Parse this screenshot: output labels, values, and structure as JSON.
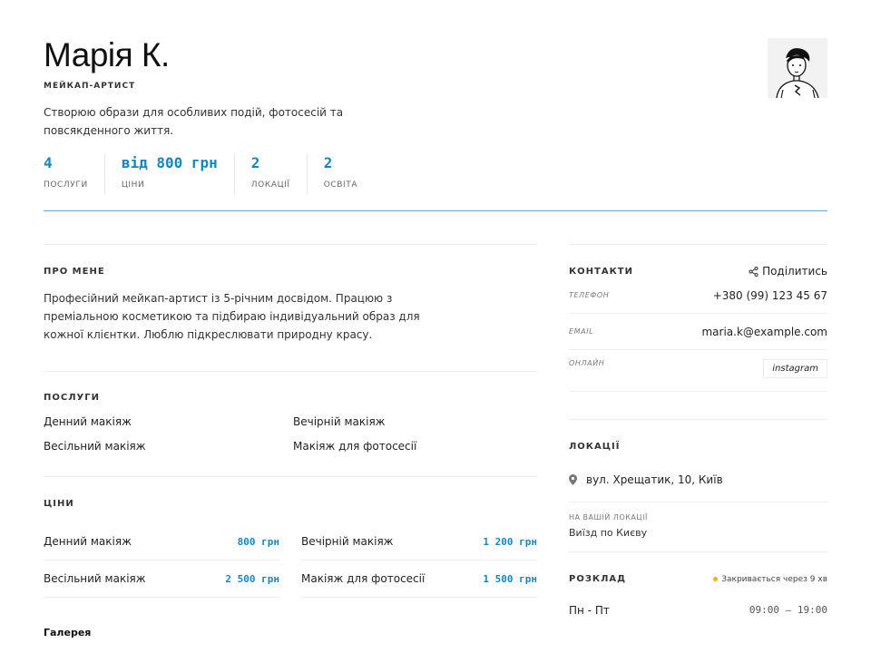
{
  "profile": {
    "name": "Марія К.",
    "role": "МЕЙКАП-АРТИСТ",
    "bio": "Створюю образи для особливих подій, фотосесій та повсякденного життя.",
    "avatar_icon": "person-illustration-icon"
  },
  "stats": [
    {
      "value": "4",
      "label": "ПОСЛУГИ"
    },
    {
      "value": "від 800 грн",
      "label": "ЦІНИ"
    },
    {
      "value": "2",
      "label": "ЛОКАЦІЇ"
    },
    {
      "value": "2",
      "label": "ОСВІТА"
    }
  ],
  "about": {
    "title": "ПРО МЕНЕ",
    "text": "Професійний мейкап-артист із 5-річним досвідом. Працюю з преміальною косметикою та підбираю індивідуальний образ для кожної клієнтки. Люблю підкреслювати природну красу."
  },
  "services": {
    "title": "ПОСЛУГИ",
    "items": [
      "Денний макіяж",
      "Вечірній макіяж",
      "Весільний макіяж",
      "Макіяж для фотосесії"
    ]
  },
  "prices": {
    "title": "ЦІНИ",
    "items": [
      {
        "name": "Денний макіяж",
        "price": "800 грн"
      },
      {
        "name": "Вечірній макіяж",
        "price": "1 200 грн"
      },
      {
        "name": "Весільний макіяж",
        "price": "2 500 грн"
      },
      {
        "name": "Макіяж для фотосесії",
        "price": "1 500 грн"
      }
    ]
  },
  "gallery": {
    "title": "Галерея"
  },
  "contacts": {
    "title": "КОНТАКТИ",
    "share_label": "Поділитись",
    "phone_label": "ТЕЛЕФОН",
    "phone": "+380 (99) 123 45 67",
    "email_label": "EMAIL",
    "email": "maria.k@example.com",
    "online_label": "ОНЛАЙН",
    "instagram": "instagram"
  },
  "locations": {
    "title": "ЛОКАЦІЇ",
    "address": "вул. Хрещатик, 10, Київ",
    "your_location_label": "НА ВАШІЙ ЛОКАЦІЇ",
    "your_location_text": "Виїзд по Києву"
  },
  "schedule": {
    "title": "РОЗКЛАД",
    "status": "Закривається через 9 хв",
    "status_color": "#f2b01e",
    "days": "Пн - Пт",
    "hours": "09:00 — 19:00"
  },
  "colors": {
    "accent": "#1a86b8"
  }
}
